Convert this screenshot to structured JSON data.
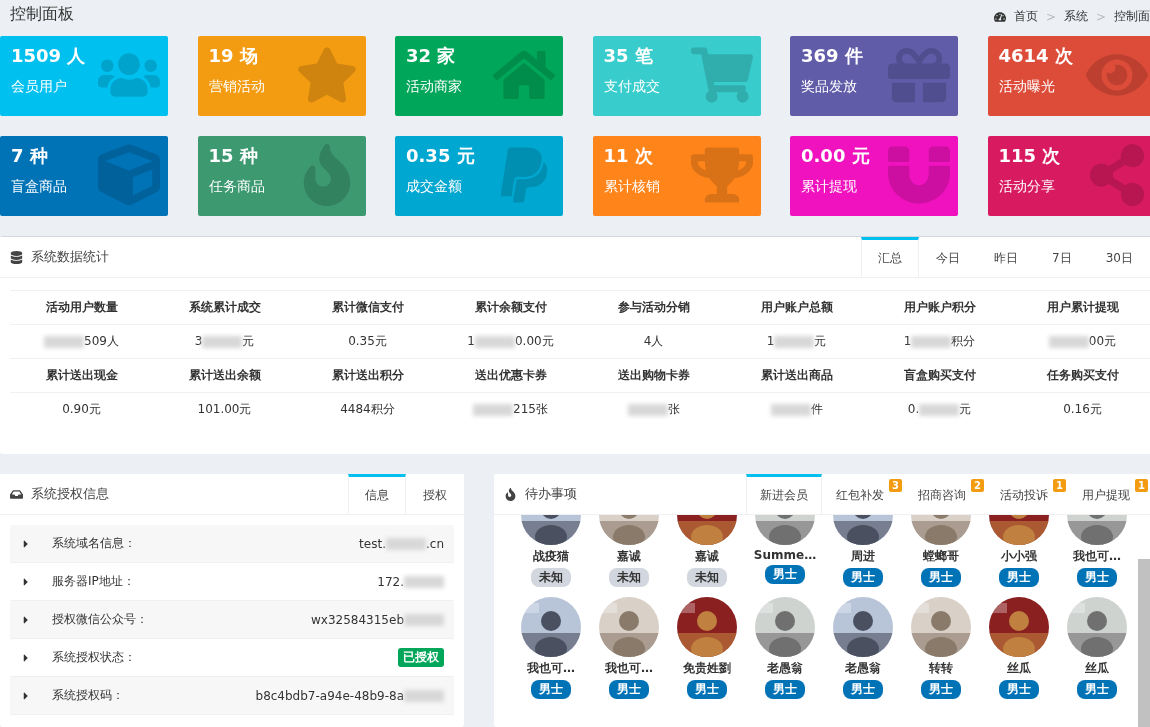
{
  "page": {
    "title": "控制面板",
    "breadcrumb": {
      "separator": ">",
      "items": [
        "首页",
        "系统",
        "控制面"
      ]
    }
  },
  "cards": [
    {
      "value": "1509 人",
      "label": "会员用户",
      "color": "#00c0ef"
    },
    {
      "value": "19 场",
      "label": "营销活动",
      "color": "#f39c12"
    },
    {
      "value": "32 家",
      "label": "活动商家",
      "color": "#00a65a"
    },
    {
      "value": "35 笔",
      "label": "支付成交",
      "color": "#39cccc"
    },
    {
      "value": "369 件",
      "label": "奖品发放",
      "color": "#605ca8"
    },
    {
      "value": "4614 次",
      "label": "活动曝光",
      "color": "#dd4b39"
    },
    {
      "value": "7 种",
      "label": "盲盒商品",
      "color": "#0073b7"
    },
    {
      "value": "15 种",
      "label": "任务商品",
      "color": "#3d9970"
    },
    {
      "value": "0.35 元",
      "label": "成交金额",
      "color": "#00a7d0"
    },
    {
      "value": "11 次",
      "label": "累计核销",
      "color": "#ff851b"
    },
    {
      "value": "0.00 元",
      "label": "累计提现",
      "color": "#f012be"
    },
    {
      "value": "115 次",
      "label": "活动分享",
      "color": "#d81b60"
    }
  ],
  "stats": {
    "title": "系统数据统计",
    "tabs": [
      {
        "label": "汇总",
        "selected": true
      },
      {
        "label": "今日",
        "selected": false
      },
      {
        "label": "昨日",
        "selected": false
      },
      {
        "label": "7日",
        "selected": false
      },
      {
        "label": "30日",
        "selected": false
      }
    ],
    "rows": [
      [
        {
          "label": "活动用户数量",
          "parts": [
            "509人"
          ],
          "blur_start": true
        },
        {
          "label": "系统累计成交",
          "parts": [
            "3",
            "元"
          ],
          "blur_mid": true
        },
        {
          "label": "累计微信支付",
          "parts": [
            "0.35元"
          ]
        },
        {
          "label": "累计余额支付",
          "parts": [
            "1",
            "0.00元"
          ],
          "blur_mid": true
        },
        {
          "label": "参与活动分销",
          "parts": [
            "4人"
          ]
        },
        {
          "label": "用户账户总额",
          "parts": [
            "1",
            "元"
          ],
          "blur_mid": true
        },
        {
          "label": "用户账户积分",
          "parts": [
            "1",
            "积分"
          ],
          "blur_mid": true
        },
        {
          "label": "用户累计提现",
          "parts": [
            "00元"
          ],
          "blur_start": true
        }
      ],
      [
        {
          "label": "累计送出现金",
          "parts": [
            "0.90元"
          ]
        },
        {
          "label": "累计送出余额",
          "parts": [
            "101.00元"
          ]
        },
        {
          "label": "累计送出积分",
          "parts": [
            "4484积分"
          ]
        },
        {
          "label": "送出优惠卡券",
          "parts": [
            "215张"
          ],
          "blur_start": true
        },
        {
          "label": "送出购物卡券",
          "parts": [
            "张"
          ],
          "blur_start": true
        },
        {
          "label": "累计送出商品",
          "parts": [
            "件"
          ],
          "blur_start": true
        },
        {
          "label": "盲盒购买支付",
          "parts": [
            "0.",
            "元"
          ],
          "blur_mid": true
        },
        {
          "label": "任务购买支付",
          "parts": [
            "0.16元"
          ]
        }
      ]
    ]
  },
  "license": {
    "title": "系统授权信息",
    "tabs": [
      {
        "label": "信息",
        "selected": true
      },
      {
        "label": "授权",
        "selected": false
      }
    ],
    "items": [
      {
        "kind": "text",
        "label": "系统域名信息：",
        "parts": [
          "test.",
          ".cn"
        ],
        "blur_mid": true
      },
      {
        "kind": "text",
        "label": "服务器IP地址：",
        "parts": [
          "172."
        ],
        "blur_end": true
      },
      {
        "kind": "text",
        "label": "授权微信公众号：",
        "parts": [
          "wx32584315eb"
        ],
        "blur_end": true
      },
      {
        "kind": "badge",
        "label": "系统授权状态：",
        "parts": [
          "已授权"
        ]
      },
      {
        "kind": "text",
        "label": "系统授权码：",
        "parts": [
          "b8c4bdb7-a94e-48b9-8a"
        ],
        "blur_end": true
      }
    ]
  },
  "todo": {
    "title": "待办事项",
    "tabs": [
      {
        "label": "新进会员",
        "selected": true
      },
      {
        "label": "红包补发",
        "selected": false,
        "count": "3"
      },
      {
        "label": "招商咨询",
        "selected": false,
        "count": "2"
      },
      {
        "label": "活动投诉",
        "selected": false,
        "count": "1"
      },
      {
        "label": "用户提现",
        "selected": false,
        "count": "1"
      }
    ],
    "members": [
      {
        "name": "战疫猫",
        "tag": "未知",
        "color": "#d2d6de"
      },
      {
        "name": "嘉诚",
        "tag": "未知",
        "color": "#d2d6de"
      },
      {
        "name": "嘉诚",
        "tag": "未知",
        "color": "#d2d6de"
      },
      {
        "name": "Summe…",
        "tag": "男士",
        "color": "#0073b7"
      },
      {
        "name": "周进",
        "tag": "男士",
        "color": "#0073b7"
      },
      {
        "name": "螳螂哥",
        "tag": "男士",
        "color": "#0073b7"
      },
      {
        "name": "小小强",
        "tag": "男士",
        "color": "#0073b7"
      },
      {
        "name": "我也可…",
        "tag": "男士",
        "color": "#0073b7"
      },
      {
        "name": "我也可…",
        "tag": "男士",
        "color": "#0073b7"
      },
      {
        "name": "我也可…",
        "tag": "男士",
        "color": "#0073b7"
      },
      {
        "name": "免贵姓劉",
        "tag": "男士",
        "color": "#0073b7"
      },
      {
        "name": "老愚翁",
        "tag": "男士",
        "color": "#0073b7"
      },
      {
        "name": "老愚翁",
        "tag": "男士",
        "color": "#0073b7"
      },
      {
        "name": "转转",
        "tag": "男士",
        "color": "#0073b7"
      },
      {
        "name": "丝瓜",
        "tag": "男士",
        "color": "#0073b7"
      },
      {
        "name": "丝瓜",
        "tag": "男士",
        "color": "#0073b7"
      }
    ]
  }
}
